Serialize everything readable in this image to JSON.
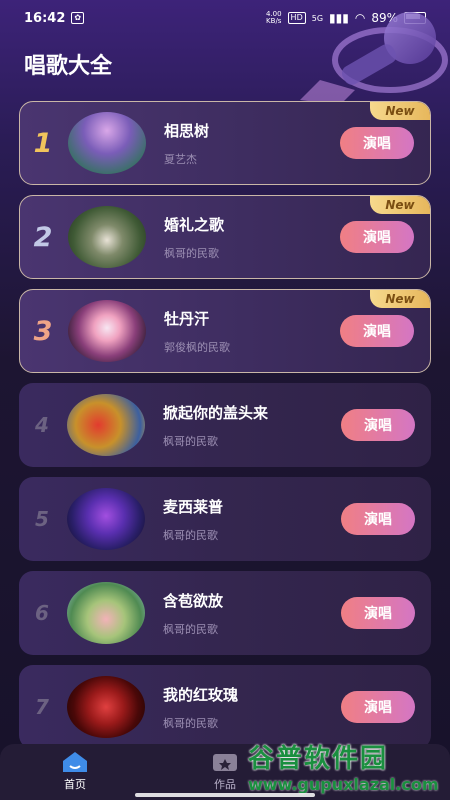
{
  "status": {
    "time": "16:42",
    "speed_value": "4.00",
    "speed_unit": "KB/s",
    "hd_badge": "HD",
    "network": "5G",
    "battery": "89%"
  },
  "header": {
    "title": "唱歌大全"
  },
  "songs": [
    {
      "rank": "1",
      "title": "相思树",
      "artist": "夏艺杰",
      "button": "演唱",
      "tag": "New"
    },
    {
      "rank": "2",
      "title": "婚礼之歌",
      "artist": "枫哥的民歌",
      "button": "演唱",
      "tag": "New"
    },
    {
      "rank": "3",
      "title": "牡丹汗",
      "artist": "郭俊枫的民歌",
      "button": "演唱",
      "tag": "New"
    },
    {
      "rank": "4",
      "title": "掀起你的盖头来",
      "artist": "枫哥的民歌",
      "button": "演唱"
    },
    {
      "rank": "5",
      "title": "麦西莱普",
      "artist": "枫哥的民歌",
      "button": "演唱"
    },
    {
      "rank": "6",
      "title": "含苞欲放",
      "artist": "枫哥的民歌",
      "button": "演唱"
    },
    {
      "rank": "7",
      "title": "我的红玫瑰",
      "artist": "枫哥的民歌",
      "button": "演唱"
    }
  ],
  "nav": {
    "home": "首页",
    "works": "作品"
  },
  "watermark": {
    "title": "谷普软件园",
    "url": "www.gupuxlazal.com"
  },
  "colors": {
    "accent": "#f07f84",
    "accent2": "#d476c4",
    "background": "#1d1532"
  }
}
